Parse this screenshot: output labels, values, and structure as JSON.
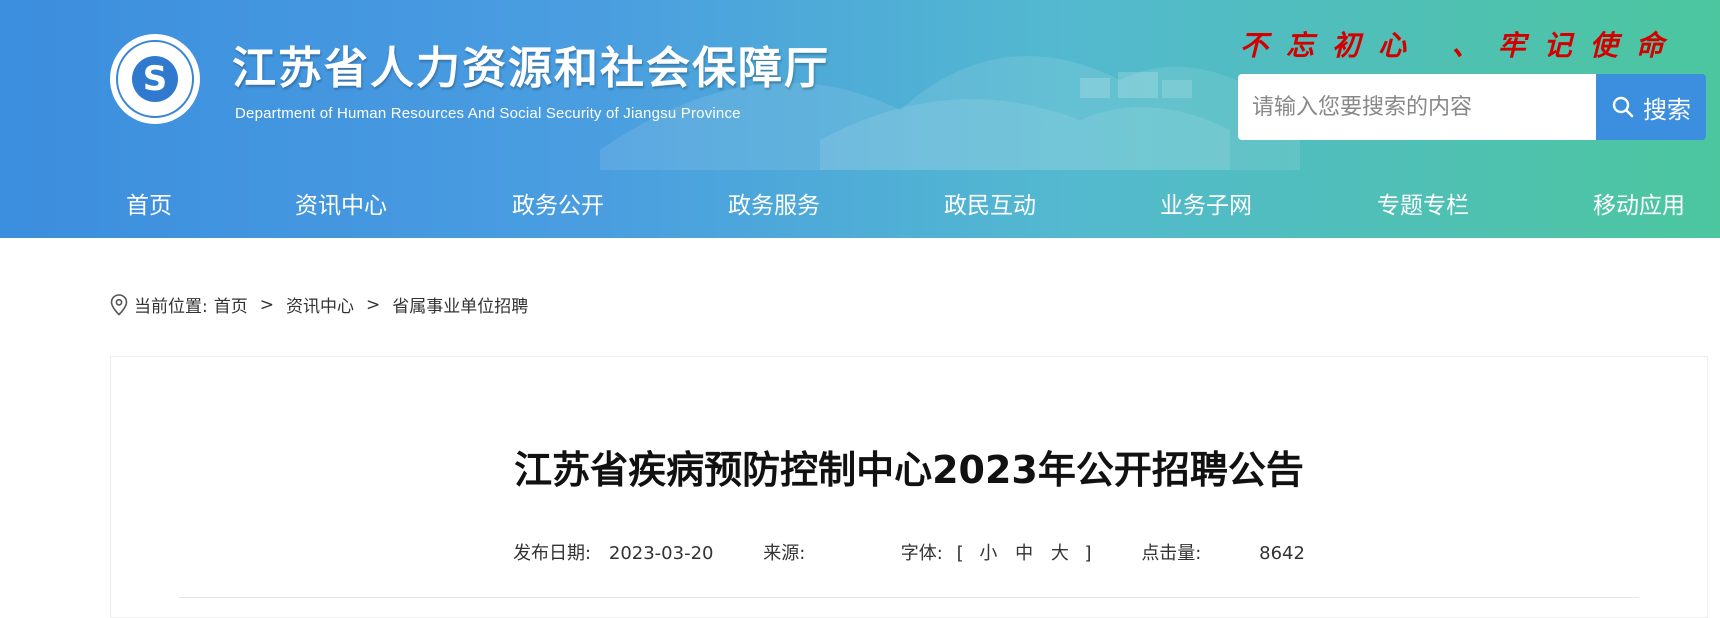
{
  "header": {
    "title": "江苏省人力资源和社会保障厅",
    "subtitle": "Department of Human Resources And Social Security of Jiangsu Province",
    "logo_ring_text": "江苏省人力资源和社会保障厅",
    "logo_glyph": "S",
    "slogan": "不忘初心 、牢记使命"
  },
  "search": {
    "placeholder": "请输入您要搜索的内容",
    "button_label": "搜索"
  },
  "nav": {
    "items": [
      "首页",
      "资讯中心",
      "政务公开",
      "政务服务",
      "政民互动",
      "业务子网",
      "专题专栏",
      "移动应用"
    ]
  },
  "breadcrumb": {
    "prefix": "当前位置:",
    "items": [
      "首页",
      "资讯中心",
      "省属事业单位招聘"
    ],
    "separator": ">"
  },
  "article": {
    "title": "江苏省疾病预防控制中心2023年公开招聘公告",
    "publish_label": "发布日期:",
    "publish_date": "2023-03-20",
    "source_label": "来源:",
    "source_value": "",
    "font_label": "字体:",
    "font_open": "[",
    "font_small": "小",
    "font_medium": "中",
    "font_large": "大",
    "font_close": "]",
    "views_label": "点击量:",
    "views": "8642"
  },
  "colors": {
    "header_start": "#3c8ede",
    "header_end": "#4cc69e",
    "search_button": "#3c8fde",
    "slogan": "#d40000"
  }
}
